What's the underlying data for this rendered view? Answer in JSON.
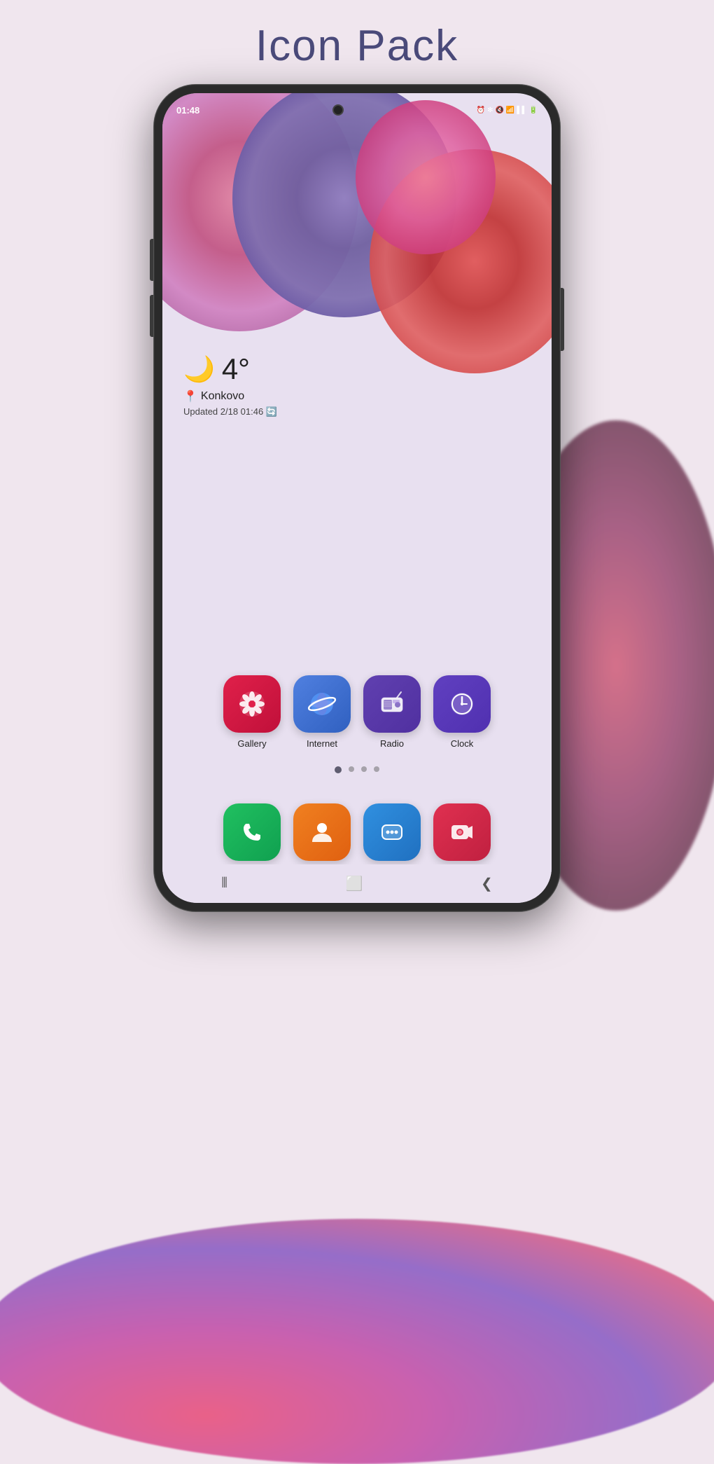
{
  "page": {
    "title": "Icon Pack"
  },
  "phone": {
    "status_bar": {
      "time": "01:48",
      "icons": [
        "⚡",
        "📶",
        "🔋"
      ]
    },
    "weather": {
      "icon": "🌙",
      "temperature": "4°",
      "location": "Konkovo",
      "updated": "Updated 2/18 01:46 🔄"
    },
    "apps": [
      {
        "id": "gallery",
        "label": "Gallery",
        "bg": "#e0204a"
      },
      {
        "id": "internet",
        "label": "Internet",
        "bg": "#3060c0"
      },
      {
        "id": "radio",
        "label": "Radio",
        "bg": "#5030a0"
      },
      {
        "id": "clock",
        "label": "Clock",
        "bg": "#5030b0"
      }
    ],
    "dock_apps": [
      {
        "id": "phone",
        "label": "Phone",
        "bg": "#10a050"
      },
      {
        "id": "contacts",
        "label": "Contacts",
        "bg": "#e06010"
      },
      {
        "id": "messages",
        "label": "Messages",
        "bg": "#2070c0"
      },
      {
        "id": "camera",
        "label": "Camera",
        "bg": "#c02040"
      }
    ],
    "page_indicators": [
      {
        "active": true
      },
      {
        "active": false
      },
      {
        "active": false
      },
      {
        "active": false
      }
    ],
    "nav": {
      "back": "❮",
      "home": "⬜",
      "recent": "⦀"
    }
  },
  "colors": {
    "background": "#f0e6ee",
    "title": "#4a4a7a",
    "screen_bg": "#e8e0f0"
  }
}
